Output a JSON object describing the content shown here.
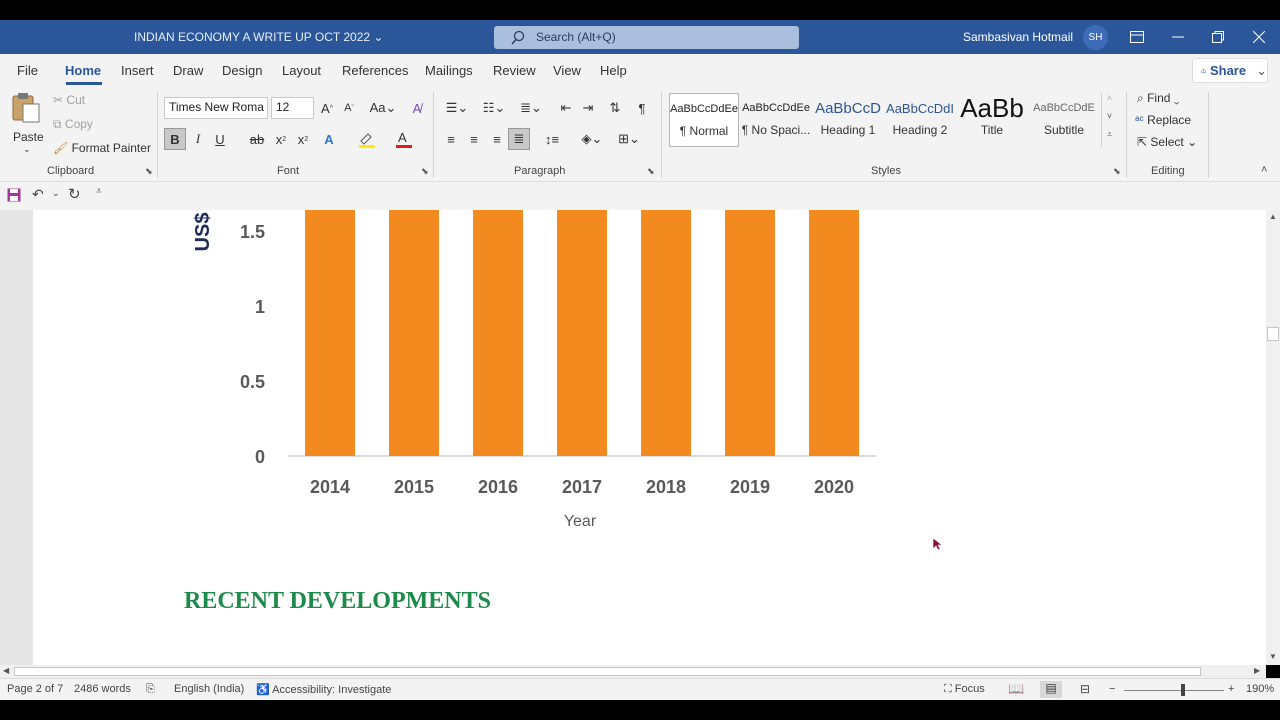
{
  "titlebar": {
    "doc_title": "INDIAN ECONOMY A WRITE UP OCT 2022",
    "search_placeholder": "Search (Alt+Q)",
    "user_name": "Sambasivan Hotmail",
    "user_initials": "SH"
  },
  "tabs": [
    "File",
    "Home",
    "Insert",
    "Draw",
    "Design",
    "Layout",
    "References",
    "Mailings",
    "Review",
    "View",
    "Help"
  ],
  "share_label": "Share",
  "clipboard": {
    "paste": "Paste",
    "cut": "Cut",
    "copy": "Copy",
    "format_painter": "Format Painter",
    "label": "Clipboard"
  },
  "font": {
    "family": "Times New Roma",
    "size": "12",
    "label": "Font"
  },
  "paragraph": {
    "label": "Paragraph"
  },
  "styles": {
    "label": "Styles",
    "items": [
      {
        "sample": "AaBbCcDdEe",
        "name": "¶ Normal"
      },
      {
        "sample": "AaBbCcDdEe",
        "name": "¶ No Spaci..."
      },
      {
        "sample": "AaBbCcD",
        "name": "Heading 1"
      },
      {
        "sample": "AaBbCcDdI",
        "name": "Heading 2"
      },
      {
        "sample": "AaBb",
        "name": "Title"
      },
      {
        "sample": "AaBbCcDdE",
        "name": "Subtitle"
      }
    ]
  },
  "editing": {
    "find": "Find",
    "replace": "Replace",
    "select": "Select",
    "label": "Editing"
  },
  "chart_data": {
    "type": "bar",
    "categories": [
      "2014",
      "2015",
      "2016",
      "2017",
      "2018",
      "2019",
      "2020"
    ],
    "values": [
      1.7,
      1.7,
      1.7,
      1.7,
      1.7,
      1.7,
      1.7
    ],
    "xlabel": "Year",
    "ylabel": "US$",
    "yticks": [
      "0",
      "0.5",
      "1",
      "1.5"
    ],
    "ylim": [
      0,
      1.5
    ],
    "color": "#f28a1f",
    "grid": false
  },
  "document": {
    "heading": "RECENT DEVELOPMENTS"
  },
  "statusbar": {
    "page": "Page 2 of 7",
    "words": "2486 words",
    "language": "English (India)",
    "accessibility": "Accessibility: Investigate",
    "focus": "Focus",
    "zoom": "190%"
  }
}
